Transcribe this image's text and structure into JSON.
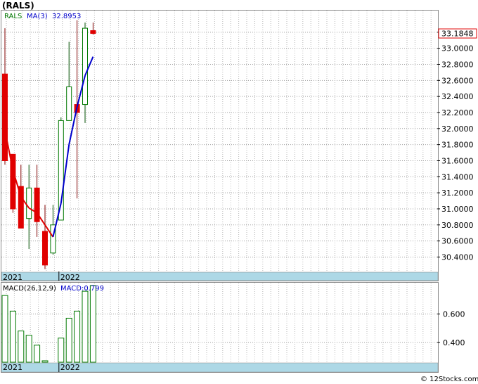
{
  "chart_data": [
    {
      "type": "candlestick",
      "title": "(RALS)",
      "legend": {
        "symbol": "RALS",
        "ma_label": "MA(3)",
        "ma_value": "32.8953"
      },
      "last_price_label": "33.1848",
      "last_price": 33.1848,
      "ylim": [
        30.22,
        33.47
      ],
      "yticks": [
        "33.2000",
        "33.0000",
        "32.8000",
        "32.6000",
        "32.4000",
        "32.2000",
        "32.0000",
        "31.8000",
        "31.6000",
        "31.4000",
        "31.2000",
        "31.0000",
        "30.8000",
        "30.6000",
        "30.4000"
      ],
      "x_labels": [
        {
          "label": "2021",
          "index": 0
        },
        {
          "label": "2022",
          "index": 7
        }
      ],
      "candles": [
        {
          "open": 32.68,
          "high": 33.25,
          "low": 31.55,
          "close": 31.6
        },
        {
          "open": 31.68,
          "high": 31.68,
          "low": 30.95,
          "close": 31.0
        },
        {
          "open": 31.28,
          "high": 31.55,
          "low": 30.8,
          "close": 30.76
        },
        {
          "open": 30.88,
          "high": 31.55,
          "low": 30.5,
          "close": 31.26
        },
        {
          "open": 31.26,
          "high": 31.55,
          "low": 30.65,
          "close": 30.84
        },
        {
          "open": 30.72,
          "high": 31.05,
          "low": 30.25,
          "close": 30.3
        },
        {
          "open": 30.45,
          "high": 31.05,
          "low": 30.43,
          "close": 30.8
        },
        {
          "open": 30.86,
          "high": 32.14,
          "low": 30.86,
          "close": 32.1
        },
        {
          "open": 32.1,
          "high": 33.08,
          "low": 32.1,
          "close": 32.52
        },
        {
          "open": 32.3,
          "high": 33.35,
          "low": 31.13,
          "close": 32.2
        },
        {
          "open": 32.3,
          "high": 33.32,
          "low": 32.07,
          "close": 33.25
        },
        {
          "open": 33.22,
          "high": 33.32,
          "low": 33.17,
          "close": 33.1848
        }
      ],
      "ma3": [
        31.98,
        31.48,
        31.15,
        31.01,
        30.95,
        30.8,
        30.65,
        31.07,
        31.8,
        32.27,
        32.66,
        32.8953
      ],
      "colors": {
        "up": "#007800",
        "down": "#e00000",
        "ma_down": "#e00000",
        "ma_up": "#0000cc"
      }
    },
    {
      "type": "bar",
      "title": "MACD(26,12,9)",
      "macd_label": "MACD:0.799",
      "yticks": [
        "0.600",
        "0.400"
      ],
      "ylim": [
        0.26,
        0.82
      ],
      "x_labels": [
        {
          "label": "2021",
          "index": 0
        },
        {
          "label": "2022",
          "index": 7
        }
      ],
      "values": [
        0.73,
        0.62,
        0.48,
        0.45,
        0.38,
        0.27,
        0.24,
        0.43,
        0.57,
        0.62,
        0.76,
        0.8
      ]
    }
  ],
  "footer": {
    "watermark": "© 12Stocks.com"
  }
}
